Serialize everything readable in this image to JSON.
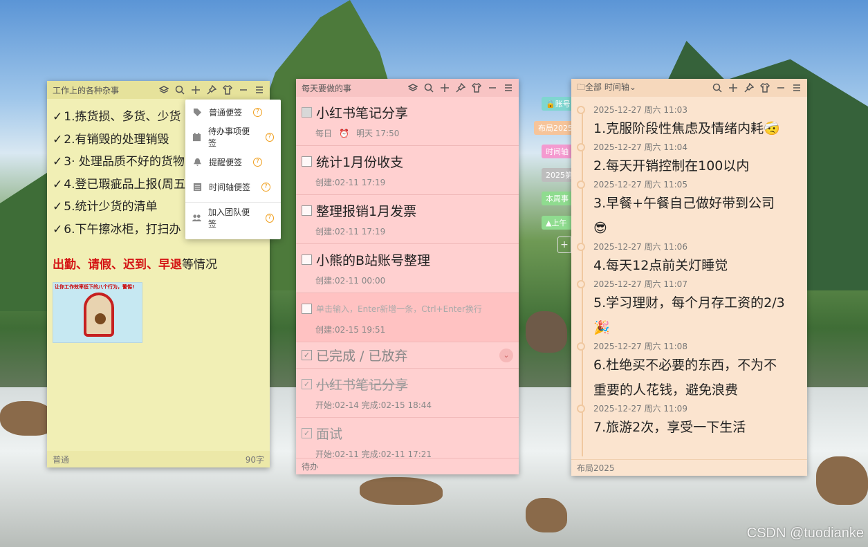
{
  "watermark": "CSDN @tuodianke",
  "note1": {
    "title": "工作上的各种杂事",
    "lines": [
      "1.拣货损、多货、少货",
      "2.有销毁的处理销毁",
      "3· 处理品质不好的货物",
      "4.登已瑕疵品上报(周五",
      "5.统计少货的清单",
      "6.下午擦冰柜，打扫办"
    ],
    "check_glyph": "✓",
    "red_parts": [
      "出勤",
      "、",
      "请假",
      "、",
      "迟到",
      "、",
      "早退"
    ],
    "red_suffix": "等情况",
    "image_caption": "让你工作效率低下的八个行为，警惕!",
    "footer_left": "普通",
    "footer_right": "90字"
  },
  "menu": {
    "items": [
      {
        "label": "普通便签",
        "icon": "tag-icon"
      },
      {
        "label": "待办事项便签",
        "icon": "calendar-check-icon"
      },
      {
        "label": "提醒便签",
        "icon": "bell-icon"
      },
      {
        "label": "时间轴便签",
        "icon": "list-icon"
      },
      {
        "label": "加入团队便签",
        "icon": "team-icon"
      }
    ],
    "help_glyph": "?"
  },
  "note2": {
    "title": "每天要做的事",
    "todos": [
      {
        "text": "小红书笔记分享",
        "meta1": "每日",
        "meta2": "明天 17:50"
      },
      {
        "text": "统计1月份收支",
        "meta1": "创建:02-11 17:19"
      },
      {
        "text": "整理报销1月发票",
        "meta1": "创建:02-11 17:19"
      },
      {
        "text": "小熊的B站账号整理",
        "meta1": "创建:02-11 00:00"
      }
    ],
    "input_placeholder": "单击输入，Enter新增一条，Ctrl+Enter换行",
    "input_meta": "创建:02-15 19:51",
    "done_header": "已完成 / 已放弃",
    "done": [
      {
        "text": "小红书笔记分享",
        "meta": "开始:02-14 完成:02-15 18:44",
        "strike": true
      },
      {
        "text": "面试",
        "meta": "开始:02-11 完成:02-11 17:21",
        "strike": false
      }
    ],
    "footer_left": "待办"
  },
  "side_tabs": [
    {
      "label": "账号",
      "color": "#7fd6d0"
    },
    {
      "label": "布局2025",
      "color": "#f6c49a"
    },
    {
      "label": "时间轴",
      "color": "#f49ad0"
    },
    {
      "label": "2025第",
      "color": "#bdbdbd"
    },
    {
      "label": "本周事",
      "color": "#8fdc8f"
    },
    {
      "label": "▲上午",
      "color": "#8fdc8f"
    }
  ],
  "note3": {
    "folder_label": "全部",
    "title": "时间轴",
    "items": [
      {
        "time": "2025-12-27 周六 11:03",
        "text": "1.克服阶段性焦虑及情绪内耗🤕"
      },
      {
        "time": "2025-12-27 周六 11:04",
        "text": "2.每天开销控制在100以内"
      },
      {
        "time": "2025-12-27 周六 11:05",
        "text": "3.早餐+午餐自己做好带到公司",
        "extra": "😎"
      },
      {
        "time": "2025-12-27 周六 11:06",
        "text": "4.每天12点前关灯睡觉"
      },
      {
        "time": "2025-12-27 周六 11:07",
        "text": "5.学习理财，每个月存工资的2/3",
        "extra": "🎉"
      },
      {
        "time": "2025-12-27 周六 11:08",
        "text": "6.杜绝买不必要的东西，不为不",
        "text2": "重要的人花钱，避免浪费"
      },
      {
        "time": "2025-12-27 周六 11:09",
        "text": "7.旅游2次，享受一下生活"
      }
    ],
    "footer_left": "布局2025"
  }
}
